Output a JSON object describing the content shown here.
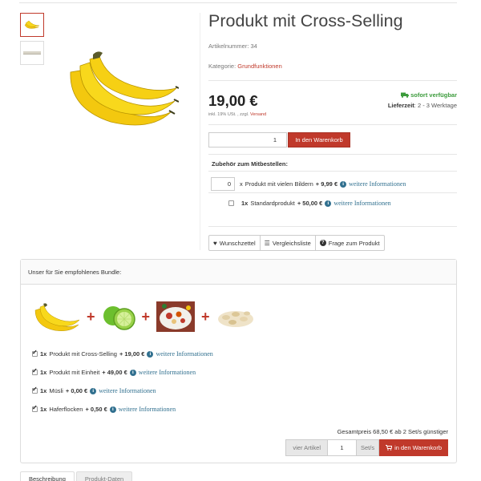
{
  "product": {
    "title": "Produkt mit Cross-Selling",
    "artnr": "Artikelnummer: 34",
    "category_label": "Kategorie:",
    "category_link": "Grundfunktionen",
    "price": "19,00 €",
    "vat_text": "inkl. 19% USt. , zzgl.",
    "vat_link": "Versand",
    "stock": "sofort verfügbar",
    "delivery_label": "Lieferzeit",
    "delivery_value": ": 2 - 3 Werktage",
    "qty": "1",
    "cart_label": "In den Warenkorb"
  },
  "accessories": {
    "title": "Zubehör zum Mitbestellen:",
    "items": [
      {
        "qty": "0",
        "prefix": "x",
        "name": "Produkt mit vielen Bildern",
        "price": "+ 9,99 €",
        "link": "weitere Informationen"
      },
      {
        "qty": "1x",
        "name": "Standardprodukt",
        "price": "+ 50,00 €",
        "link": "weitere Informationen"
      }
    ]
  },
  "actions": {
    "wishlist": "Wunschzettel",
    "compare": "Vergleichsliste",
    "question": "Frage zum Produkt"
  },
  "bundle": {
    "title": "Unser für Sie empfohlenes Bundle:",
    "items": [
      {
        "qty": "1x",
        "name": "Produkt mit Cross-Selling",
        "price": "+ 19,00 €",
        "link": "weitere Informationen"
      },
      {
        "qty": "1x",
        "name": "Produkt mit Einheit",
        "price": "+ 49,00 €",
        "link": "weitere Informationen"
      },
      {
        "qty": "1x",
        "name": "Müsli",
        "price": "+ 0,00 €",
        "link": "weitere Informationen"
      },
      {
        "qty": "1x",
        "name": "Haferflocken",
        "price": "+ 0,50 €",
        "link": "weitere Informationen"
      }
    ],
    "total": "Gesamtpreis 68,50 € ab 2 Set/s günstiger",
    "form_label": "vier Artikel",
    "form_qty": "1",
    "form_unit": "Set/s",
    "form_button": "in den Warenkorb"
  },
  "tabs": [
    "Beschreibung",
    "Produkt-Daten"
  ],
  "colors": {
    "accent": "#c0392b",
    "stock": "#3c9b3c",
    "link": "#31708f"
  }
}
